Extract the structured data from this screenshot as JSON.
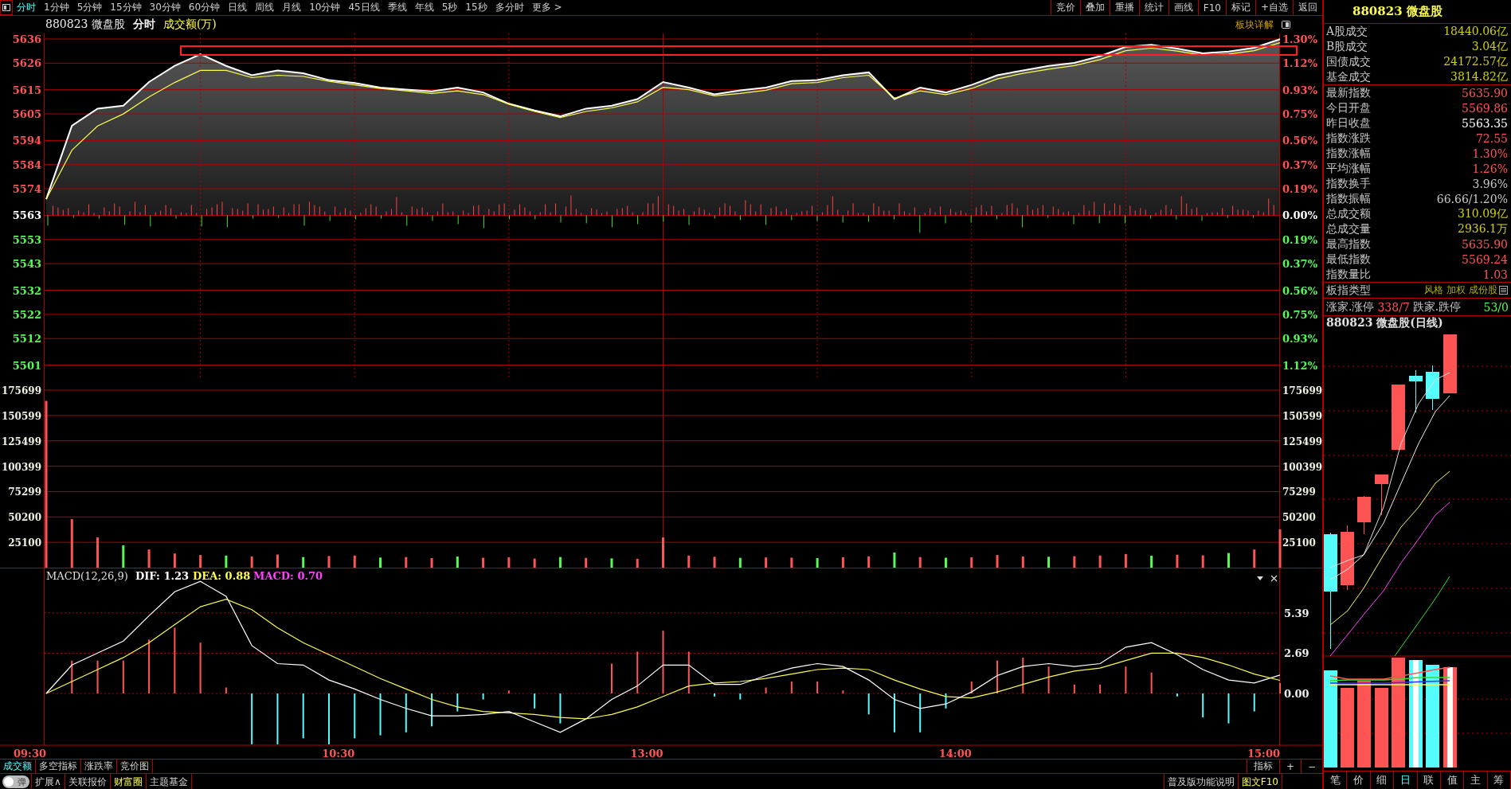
{
  "toolbar": {
    "periods": [
      {
        "label": "分时",
        "selected": true
      },
      {
        "label": "1分钟",
        "selected": false
      },
      {
        "label": "5分钟",
        "selected": false
      },
      {
        "label": "15分钟",
        "selected": false
      },
      {
        "label": "30分钟",
        "selected": false
      },
      {
        "label": "60分钟",
        "selected": false
      },
      {
        "label": "日线",
        "selected": false
      },
      {
        "label": "周线",
        "selected": false
      },
      {
        "label": "月线",
        "selected": false
      },
      {
        "label": "10分钟",
        "selected": false
      },
      {
        "label": "45日线",
        "selected": false
      },
      {
        "label": "季线",
        "selected": false
      },
      {
        "label": "年线",
        "selected": false
      },
      {
        "label": "5秒",
        "selected": false
      },
      {
        "label": "15秒",
        "selected": false
      },
      {
        "label": "多分时",
        "selected": false
      },
      {
        "label": "更多 >",
        "selected": false
      }
    ],
    "actions": [
      "竞价",
      "叠加",
      "重播",
      "统计",
      "画线",
      "F10",
      "标记",
      "+自选",
      "返回"
    ]
  },
  "chart_header": {
    "code": "880823 微盘股",
    "mode": "分时",
    "indicator": "成交额(万)",
    "detail_link": "板块详解"
  },
  "price_chart": {
    "right_ticks": [
      {
        "label": "1.30%",
        "color": "#ff5454"
      },
      {
        "label": "1.12%",
        "color": "#ff5454"
      },
      {
        "label": "0.93%",
        "color": "#ff5454"
      },
      {
        "label": "0.75%",
        "color": "#ff5454"
      },
      {
        "label": "0.56%",
        "color": "#ff5454"
      },
      {
        "label": "0.37%",
        "color": "#ff5454"
      },
      {
        "label": "0.19%",
        "color": "#ff5454"
      },
      {
        "label": "0.00%",
        "color": "#ffffff"
      },
      {
        "label": "0.19%",
        "color": "#54fc54"
      },
      {
        "label": "0.37%",
        "color": "#54fc54"
      },
      {
        "label": "0.56%",
        "color": "#54fc54"
      },
      {
        "label": "0.75%",
        "color": "#54fc54"
      },
      {
        "label": "0.93%",
        "color": "#54fc54"
      },
      {
        "label": "1.12%",
        "color": "#54fc54"
      }
    ],
    "chart_data": {
      "type": "line",
      "grid": true,
      "ylim": [
        5501,
        5636
      ],
      "yticks": [
        5636,
        5626,
        5615,
        5605,
        5594,
        5584,
        5574,
        5563,
        5553,
        5543,
        5532,
        5522,
        5512,
        5501
      ],
      "series": [
        {
          "color": "#ffffff",
          "values": [
            5569.7,
            5600.1,
            5607.2,
            5608.4,
            5618.2,
            5624.9,
            5629.7,
            5624.9,
            5621.0,
            5623.0,
            5621.8,
            5619.0,
            5617.8,
            5615.9,
            5615.1,
            5614.3,
            5615.9,
            5613.9,
            5609.2,
            5606.4,
            5604.0,
            5607.2,
            5608.4,
            5611.1,
            5618.2,
            5615.9,
            5613.1,
            5614.7,
            5615.9,
            5618.6,
            5619.0,
            5621.0,
            5622.2,
            5611.1,
            5615.9,
            5613.9,
            5617.0,
            5621.0,
            5623.0,
            5624.9,
            5626.1,
            5628.9,
            5632.8,
            5633.6,
            5632.0,
            5630.1,
            5630.8,
            5632.4,
            5635.9
          ]
        },
        {
          "color": "#fcfc54",
          "values": [
            5569.7,
            5590.0,
            5600.0,
            5605.0,
            5612.0,
            5618.0,
            5623.0,
            5623.0,
            5620.0,
            5621.0,
            5620.5,
            5618.5,
            5617.0,
            5615.5,
            5614.5,
            5613.5,
            5614.5,
            5613.0,
            5609.0,
            5606.0,
            5603.5,
            5606.0,
            5607.5,
            5610.0,
            5616.0,
            5615.0,
            5612.5,
            5613.5,
            5614.8,
            5617.5,
            5618.0,
            5620.0,
            5621.0,
            5611.5,
            5614.5,
            5613.0,
            5615.5,
            5619.5,
            5621.8,
            5623.5,
            5625.0,
            5627.5,
            5631.2,
            5632.2,
            5631.0,
            5629.3,
            5629.8,
            5631.2,
            5634.5
          ]
        }
      ]
    }
  },
  "volume_chart": {
    "left_ticks": [
      "175699",
      "150599",
      "125499",
      "100399",
      "75299",
      "50200",
      "25100"
    ],
    "right_ticks": [
      "175699",
      "150599",
      "125499",
      "100399",
      "75299",
      "50200",
      "25100"
    ],
    "chart_data": {
      "type": "bar",
      "grid": true,
      "ylim": [
        0,
        188300
      ],
      "yticks": [
        175699,
        150599,
        125499,
        100399,
        75299,
        50200,
        25100
      ],
      "series": [
        {
          "color": "#ff5454",
          "values": [
            165000,
            48000,
            30000,
            null,
            18000,
            14000,
            12500,
            null,
            11000,
            13000,
            null,
            11500,
            12000,
            null,
            10500,
            9500,
            null,
            9800,
            10200,
            9000,
            null,
            9600,
            null,
            8800,
            30000,
            12000,
            10800,
            null,
            10100,
            9900,
            null,
            10300,
            11200,
            null,
            10500,
            null,
            10200,
            12500,
            11000,
            null,
            11400,
            12000,
            13500,
            null,
            12800,
            12200,
            null,
            18000,
            38000
          ]
        },
        {
          "color": "#54fc54",
          "values": [
            null,
            null,
            null,
            22000,
            null,
            null,
            null,
            12000,
            null,
            null,
            10500,
            null,
            null,
            10000,
            null,
            null,
            11000,
            null,
            null,
            null,
            10500,
            null,
            9200,
            null,
            null,
            null,
            null,
            9700,
            null,
            null,
            9500,
            null,
            null,
            15000,
            null,
            9800,
            null,
            null,
            null,
            10800,
            null,
            null,
            null,
            11800,
            null,
            null,
            14500,
            null,
            null
          ]
        }
      ]
    }
  },
  "macd_chart": {
    "title": "MACD(12,26,9)",
    "time_labels": [
      "09:30",
      "10:30",
      "13:00",
      "14:00",
      "15:00"
    ],
    "dif": "DIF: 1.23",
    "dea": "DEA: 0.88",
    "macd": "MACD: 0.70",
    "chart_data": {
      "type": "line",
      "grid": true,
      "ylim": [
        -3.46,
        8.36
      ],
      "yticks": [
        5.39,
        2.69,
        {
          "value": 0,
          "label": "0.00"
        }
      ],
      "series": [
        {
          "color": "#ffffff",
          "values": [
            0,
            1.9,
            2.7,
            3.5,
            5.2,
            6.8,
            7.5,
            6.5,
            3.2,
            2.0,
            1.9,
            0.9,
            0.3,
            -0.4,
            -1.0,
            -1.5,
            -1.5,
            -1.4,
            -1.2,
            -1.9,
            -2.6,
            -1.7,
            -0.4,
            0.5,
            1.9,
            1.9,
            0.6,
            0.6,
            1.2,
            1.7,
            2.0,
            1.8,
            0.9,
            -0.4,
            -1.0,
            -0.7,
            0.1,
            1.2,
            1.8,
            2.0,
            1.8,
            2.0,
            3.1,
            3.4,
            2.6,
            1.6,
            0.9,
            0.7,
            1.23
          ]
        },
        {
          "color": "#fcfc54",
          "values": [
            0,
            0.8,
            1.6,
            2.4,
            3.4,
            4.6,
            5.8,
            6.3,
            5.6,
            4.4,
            3.4,
            2.6,
            1.8,
            1.0,
            0.3,
            -0.4,
            -0.9,
            -1.2,
            -1.3,
            -1.4,
            -1.6,
            -1.7,
            -1.4,
            -0.9,
            -0.2,
            0.5,
            0.7,
            0.8,
            1.0,
            1.3,
            1.6,
            1.7,
            1.6,
            0.9,
            0.3,
            -0.2,
            -0.3,
            0.1,
            0.6,
            1.1,
            1.5,
            1.7,
            2.2,
            2.7,
            2.7,
            2.4,
            1.9,
            1.3,
            0.88
          ]
        },
        {
          "color": "#ff5454",
          "type": "bar",
          "values": [
            null,
            2.2,
            2.2,
            2.2,
            3.6,
            4.4,
            3.4,
            0.4,
            null,
            null,
            null,
            null,
            null,
            null,
            null,
            null,
            null,
            null,
            0.2,
            null,
            null,
            null,
            2.0,
            2.8,
            4.2,
            2.8,
            null,
            null,
            0.4,
            0.8,
            0.8,
            0.2,
            null,
            null,
            null,
            null,
            0.8,
            2.2,
            2.4,
            1.8,
            0.6,
            0.6,
            1.8,
            1.4,
            null,
            null,
            null,
            null,
            0.7
          ]
        },
        {
          "color": "#54fcfc",
          "type": "bar",
          "values": [
            null,
            null,
            null,
            null,
            null,
            null,
            null,
            null,
            -3.4,
            -3.4,
            -3.0,
            -3.4,
            -3.0,
            -2.8,
            -2.6,
            -2.2,
            -1.2,
            -0.4,
            null,
            -1.0,
            -2.0,
            null,
            null,
            null,
            null,
            null,
            -0.2,
            -0.4,
            null,
            null,
            null,
            null,
            -1.4,
            -2.6,
            -2.6,
            -1.0,
            null,
            null,
            null,
            null,
            null,
            null,
            null,
            null,
            -0.2,
            -1.6,
            -2.0,
            -1.2,
            null
          ]
        }
      ]
    }
  },
  "indicator_tabs": [
    {
      "label": "成交额",
      "selected": true
    },
    {
      "label": "多空指标",
      "selected": false
    },
    {
      "label": "涨跌率",
      "selected": false
    },
    {
      "label": "竞价图",
      "selected": false
    }
  ],
  "indicator_tools": [
    "指标",
    "+",
    "−"
  ],
  "bottom_bar": {
    "toggle": {
      "label": "弹",
      "on": false
    },
    "links": [
      {
        "label": "扩展∧",
        "kind": "plain"
      },
      {
        "label": "关联报价",
        "kind": "plain"
      },
      {
        "label": "财富圈",
        "kind": "highlight"
      },
      {
        "label": "主题基金",
        "kind": "plain"
      }
    ],
    "right_links": [
      {
        "label": "普及版功能说明",
        "kind": "plain"
      },
      {
        "label": "图文F10",
        "kind": "highlight"
      }
    ]
  },
  "quote_panel": {
    "title": "880823 微盘股",
    "turnover": [
      {
        "label": "A股成交",
        "value": "18440.06亿",
        "color": "#d2d200"
      },
      {
        "label": "B股成交",
        "value": "3.04亿",
        "color": "#d2d200"
      },
      {
        "label": "国债成交",
        "value": "24172.57亿",
        "color": "#d2d200"
      },
      {
        "label": "基金成交",
        "value": "3814.82亿",
        "color": "#d2d200"
      }
    ],
    "stats": [
      {
        "label": "最新指数",
        "value": "5635.90",
        "color": "#ff5454"
      },
      {
        "label": "今日开盘",
        "value": "5569.86",
        "color": "#ff5454"
      },
      {
        "label": "昨日收盘",
        "value": "5563.35",
        "color": "#ffffff"
      },
      {
        "label": "指数涨跌",
        "value": "72.55",
        "color": "#ff5454"
      },
      {
        "label": "指数涨幅",
        "value": "1.30%",
        "color": "#ff5454"
      },
      {
        "label": "平均涨幅",
        "value": "1.26%",
        "color": "#ff5454"
      },
      {
        "label": "指数换手",
        "value": "3.96%",
        "color": "#c8c8c8"
      },
      {
        "label": "指数振幅",
        "value": "66.66/1.20%",
        "color": "#c8c8c8"
      },
      {
        "label": "总成交额",
        "value": "310.09亿",
        "color": "#d2d200"
      },
      {
        "label": "总成交量",
        "value": "2936.1万",
        "color": "#d2d200"
      },
      {
        "label": "最高指数",
        "value": "5635.90",
        "color": "#ff5454"
      },
      {
        "label": "最低指数",
        "value": "5569.24",
        "color": "#ff5454"
      },
      {
        "label": "指数量比",
        "value": "1.03",
        "color": "#ff5454"
      }
    ],
    "type_row": {
      "label": "板指类型",
      "tags": "风格 加权 成份股"
    },
    "breadth": {
      "up_label": "涨家.涨停",
      "up_value": "338/7",
      "down_label": "跌家.跌停",
      "down_value": "53/0"
    },
    "kline_title": "880823 微盘股(日线)",
    "tabs": [
      {
        "label": "笔",
        "selected": false
      },
      {
        "label": "价",
        "selected": false
      },
      {
        "label": "细",
        "selected": false
      },
      {
        "label": "日",
        "selected": true
      },
      {
        "label": "联",
        "selected": false
      },
      {
        "label": "值",
        "selected": false
      },
      {
        "label": "主",
        "selected": false
      },
      {
        "label": "筹",
        "selected": false
      }
    ]
  }
}
